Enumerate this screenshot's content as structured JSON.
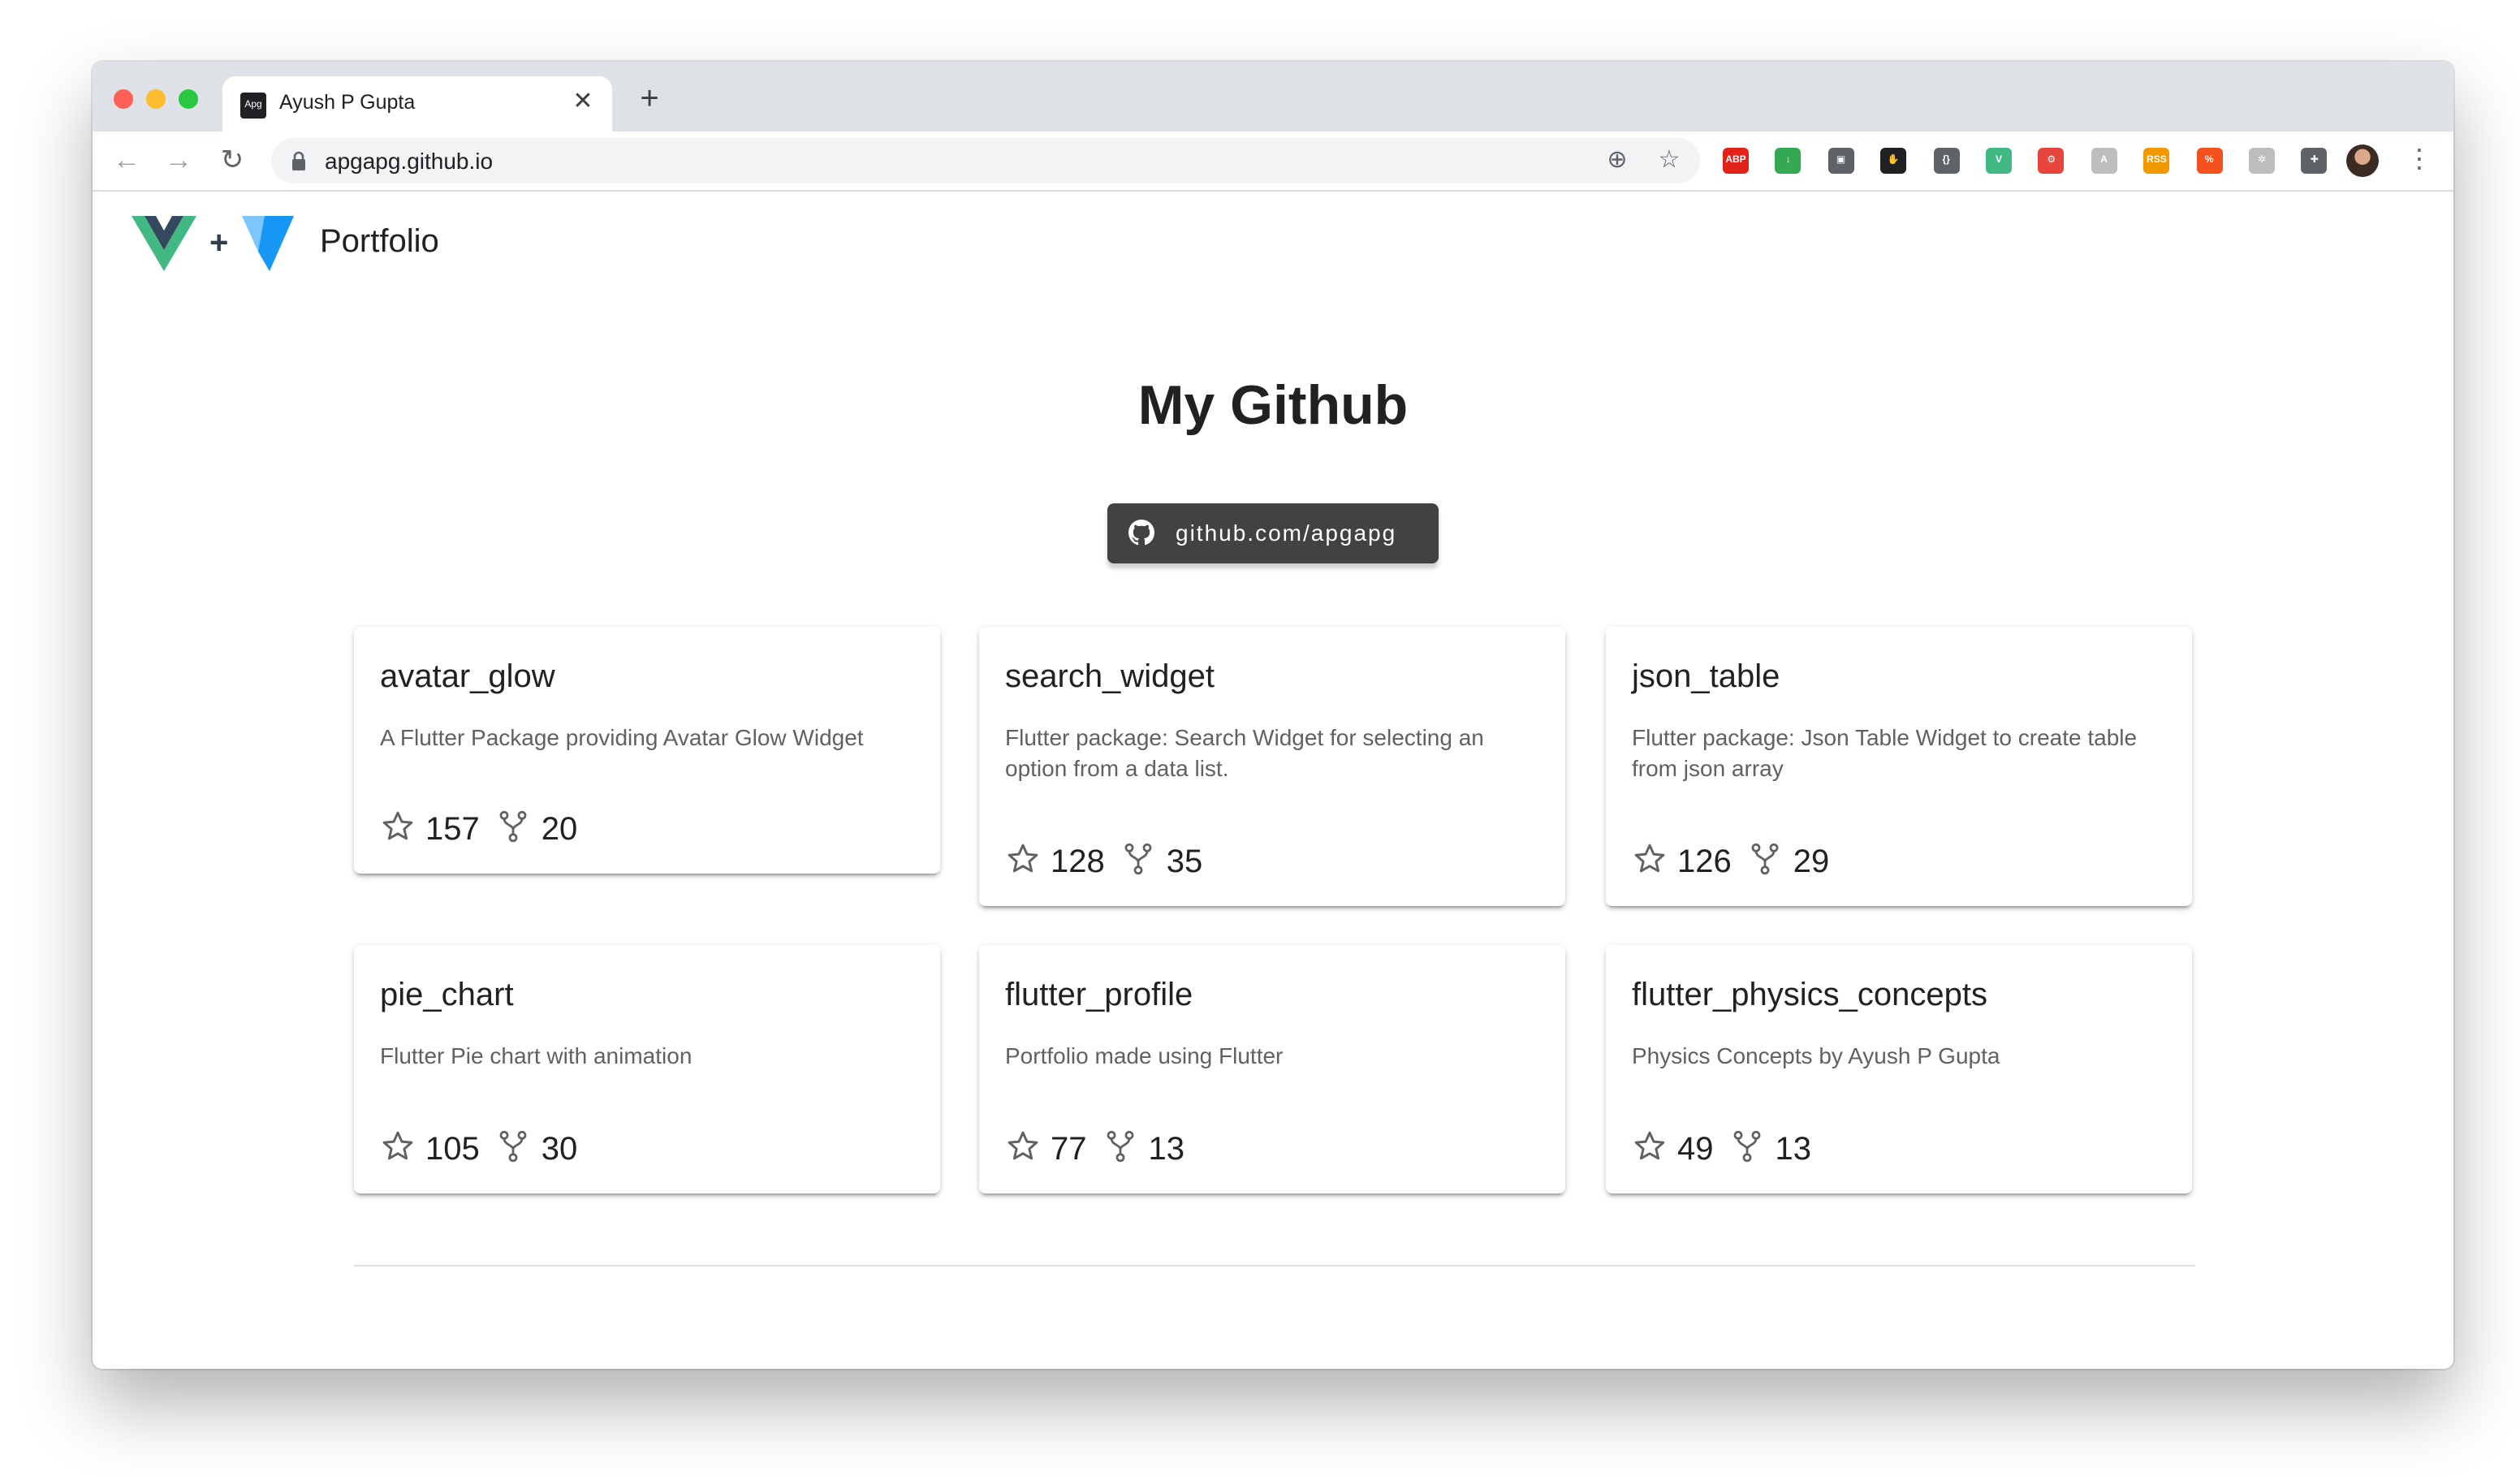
{
  "browser": {
    "tab_title": "Ayush P Gupta",
    "favicon_text": "Apg",
    "tab_close": "✕",
    "new_tab": "+",
    "url": "apgapg.github.io",
    "back": "←",
    "forward": "→",
    "reload": "↻",
    "add_icon": "⊕",
    "star_icon": "☆",
    "menu": "⋮",
    "extensions": [
      {
        "name": "adblock-icon",
        "text": "ABP",
        "color": "#e2231a"
      },
      {
        "name": "download-extension-icon",
        "text": "↓",
        "color": "#34a853"
      },
      {
        "name": "password-extension-icon",
        "text": "▣",
        "color": "#5f6368"
      },
      {
        "name": "gnome-extension-icon",
        "text": "✋",
        "color": "#202124"
      },
      {
        "name": "code-extension-icon",
        "text": "{}",
        "color": "#5f6368"
      },
      {
        "name": "vue-devtools-icon",
        "text": "V",
        "color": "#42b883"
      },
      {
        "name": "network-extension-icon",
        "text": "⚙",
        "color": "#e8453c"
      },
      {
        "name": "translate-extension-icon",
        "text": "A",
        "color": "#bdbdbd"
      },
      {
        "name": "rss-extension-icon",
        "text": "RSS",
        "color": "#f29900"
      },
      {
        "name": "percent-extension-icon",
        "text": "%",
        "color": "#f4511e"
      },
      {
        "name": "wheel-extension-icon",
        "text": "✲",
        "color": "#bdbdbd"
      },
      {
        "name": "puzzle-icon",
        "text": "✚",
        "color": "#5f6368"
      }
    ]
  },
  "header": {
    "plus": "+",
    "title": "Portfolio"
  },
  "main": {
    "title": "My Github",
    "github_button": "github.com/apgapg"
  },
  "repos": [
    {
      "name": "avatar_glow",
      "description": "A Flutter Package providing Avatar Glow Widget",
      "stars": "157",
      "forks": "20"
    },
    {
      "name": "search_widget",
      "description": "Flutter package: Search Widget for selecting an option from a data list.",
      "stars": "128",
      "forks": "35"
    },
    {
      "name": "json_table",
      "description": "Flutter package: Json Table Widget to create table from json array",
      "stars": "126",
      "forks": "29"
    },
    {
      "name": "pie_chart",
      "description": "Flutter Pie chart with animation",
      "stars": "105",
      "forks": "30"
    },
    {
      "name": "flutter_profile",
      "description": "Portfolio made using Flutter",
      "stars": "77",
      "forks": "13"
    },
    {
      "name": "flutter_physics_concepts",
      "description": "Physics Concepts by Ayush P Gupta",
      "stars": "49",
      "forks": "13"
    }
  ],
  "colors": {
    "vue_green": "#42b883",
    "vue_dark": "#35495e",
    "vuetify_light": "#7bc6ff",
    "vuetify_blue": "#1697f6",
    "button_dark": "#424242"
  }
}
